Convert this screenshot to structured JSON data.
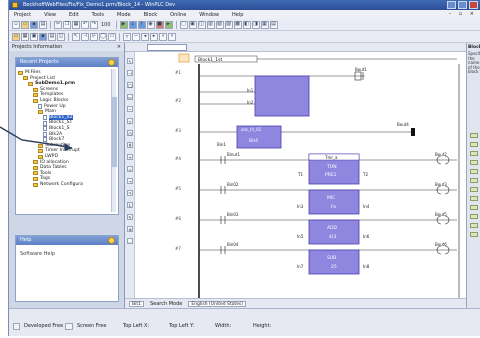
{
  "window": {
    "title": "BeckhoffWebFiles/Fix/Fix_Demo1.prm/Block_14 - WinPLC Dev"
  },
  "menu": [
    "Project",
    "View",
    "Edit",
    "Tools",
    "Mode",
    "Block",
    "Online",
    "Window",
    "Help"
  ],
  "toolbar": {
    "zoom_value": "100"
  },
  "left_pane": {
    "header": "Projects Information",
    "recent_projects_title": "Recent Projects",
    "tree": [
      {
        "label": "M:Files",
        "depth": 0,
        "kind": "folder"
      },
      {
        "label": "Project List",
        "depth": 1,
        "kind": "folder"
      },
      {
        "label": "SubDemo1.prm",
        "depth": 2,
        "kind": "folder",
        "bold": true
      },
      {
        "label": "Screens",
        "depth": 3,
        "kind": "folder"
      },
      {
        "label": "Templates",
        "depth": 3,
        "kind": "folder"
      },
      {
        "label": "Logic Blocks",
        "depth": 3,
        "kind": "folder"
      },
      {
        "label": "Power Up",
        "depth": 4,
        "kind": "page"
      },
      {
        "label": "Main",
        "depth": 4,
        "kind": "folder"
      },
      {
        "label": "Block1_02",
        "depth": 5,
        "kind": "page",
        "selected": true
      },
      {
        "label": "Block1_ST",
        "depth": 5,
        "kind": "page"
      },
      {
        "label": "Block1_S",
        "depth": 5,
        "kind": "page"
      },
      {
        "label": "Blk2A",
        "depth": 5,
        "kind": "page"
      },
      {
        "label": "Block7",
        "depth": 5,
        "kind": "page"
      },
      {
        "label": "Subroutine",
        "depth": 4,
        "kind": "folder"
      },
      {
        "label": "Timer Interrupt",
        "depth": 4,
        "kind": "folder"
      },
      {
        "label": "LWPD",
        "depth": 4,
        "kind": "folder"
      },
      {
        "label": "IO allocation",
        "depth": 3,
        "kind": "folder"
      },
      {
        "label": "Data Tables",
        "depth": 3,
        "kind": "folder"
      },
      {
        "label": "Tools",
        "depth": 3,
        "kind": "folder"
      },
      {
        "label": "Tags",
        "depth": 3,
        "kind": "folder"
      },
      {
        "label": "Network Configura",
        "depth": 3,
        "kind": "folder"
      }
    ],
    "help_title": "Help",
    "help_text": "Software Help"
  },
  "ladder": {
    "header_tag": "Block1_1st",
    "rung_numbers": [
      "#1",
      "#2",
      "#3",
      "#4",
      "#5",
      "#6",
      "#7"
    ],
    "rungs": [
      {
        "contact_top": "",
        "outputs": [
          "Bout1"
        ],
        "fb_name": "",
        "fb_lines": [
          "",
          ""
        ],
        "in_labels": [
          "In1",
          "In2"
        ]
      },
      {
        "fb_name": "anc_fn_01",
        "fb_lines": [
          "Bit4"
        ],
        "coil": "Bout4",
        "contact": "Bin1"
      },
      {
        "contact": "Binut1",
        "fb_name": "Tmr_a",
        "fb_lines": [
          "TON",
          "PRE1"
        ],
        "coil_tag": "Bout2"
      },
      {
        "contact": "Bin02",
        "fb_name": "Cnt",
        "fb_lines": [
          "MIC",
          "Fe"
        ],
        "coil_tag": "Bout3"
      },
      {
        "contact": "Bin03",
        "fb_name": "Add",
        "fb_lines": [
          "ADD",
          "4/3"
        ],
        "coil_tag": "Bout5"
      },
      {
        "contact": "Bin04",
        "fb_name": "Sub",
        "fb_lines": [
          "SUB",
          "25"
        ],
        "coil_tag": "Bout6"
      }
    ],
    "pins": [
      "T1",
      "T2",
      "In3",
      "In4",
      "In5",
      "In6",
      "In7",
      "In8"
    ]
  },
  "bottom_toolbar": {
    "item1": "Bit1",
    "search_label": "Search Mode",
    "search_value": "English (United States)"
  },
  "right_pane": {
    "title": "Block",
    "text": "Specify the name of the block"
  },
  "status": {
    "mode": "Developed Free",
    "screen": "Screen Free",
    "top_left_x": "Top Left X:",
    "top_left_y": "Top Left Y:",
    "width": "Width:",
    "height": "Height:"
  },
  "colors": {
    "fb_fill": "#8f86e0",
    "fb_border": "#4a3fb2",
    "titlebar": "#3f6ab4"
  }
}
